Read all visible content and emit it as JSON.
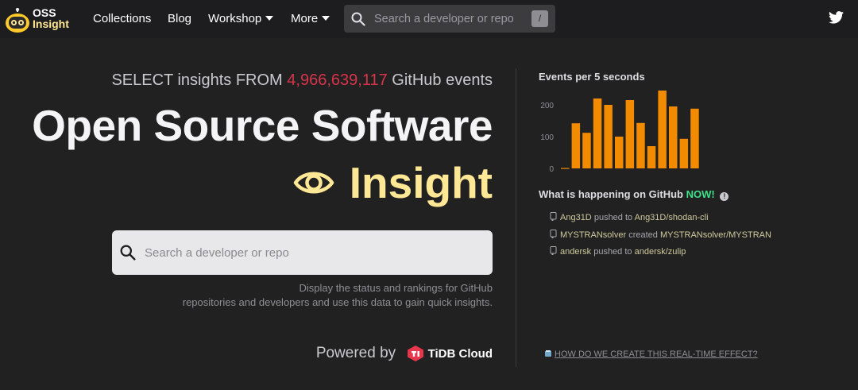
{
  "nav": {
    "logo_line1": "OSS",
    "logo_line2": "Insight",
    "links": [
      "Collections",
      "Blog",
      "Workshop",
      "More"
    ],
    "search_placeholder": "Search a developer or repo",
    "search_shortcut": "/"
  },
  "hero": {
    "subtitle_prefix": "SELECT insights FROM",
    "event_count": "4,966,639,117",
    "subtitle_suffix": "GitHub events",
    "title": "Open Source Software",
    "title_highlight": "Insight",
    "search_placeholder": "Search a developer or repo",
    "description_line1": "Display the status and rankings for GitHub",
    "description_line2": "repositories and developers and use this data to gain quick insights.",
    "powered_by": "Powered by",
    "brand": "TiDB Cloud"
  },
  "events_panel": {
    "happening_prefix": "What is happening on GitHub",
    "happening_now": "NOW!",
    "info_icon": "!",
    "events": [
      {
        "actor": "Ang31D",
        "action": "pushed to",
        "target": "Ang31D/shodan-cli"
      },
      {
        "actor": "MYSTRANsolver",
        "action": "created",
        "target": "MYSTRANsolver/MYSTRAN"
      },
      {
        "actor": "andersk",
        "action": "pushed to",
        "target": "andersk/zulip"
      }
    ],
    "how_link": "HOW DO WE CREATE THIS REAL-TIME EFFECT?"
  },
  "colors": {
    "accent_red": "#d8344a",
    "accent_yellow": "#ffe895",
    "bar_orange": "#f28b00",
    "now_green": "#3ee08a"
  },
  "chart_data": {
    "type": "bar",
    "title": "Events per 5 seconds",
    "ylim": [
      0,
      250
    ],
    "y_ticks": [
      0,
      100,
      200
    ],
    "y_tick_labels": [
      "0",
      "100",
      "200"
    ],
    "values": [
      0,
      142,
      112,
      220,
      200,
      100,
      215,
      143,
      70,
      245,
      195,
      93,
      188
    ],
    "grid": false
  }
}
